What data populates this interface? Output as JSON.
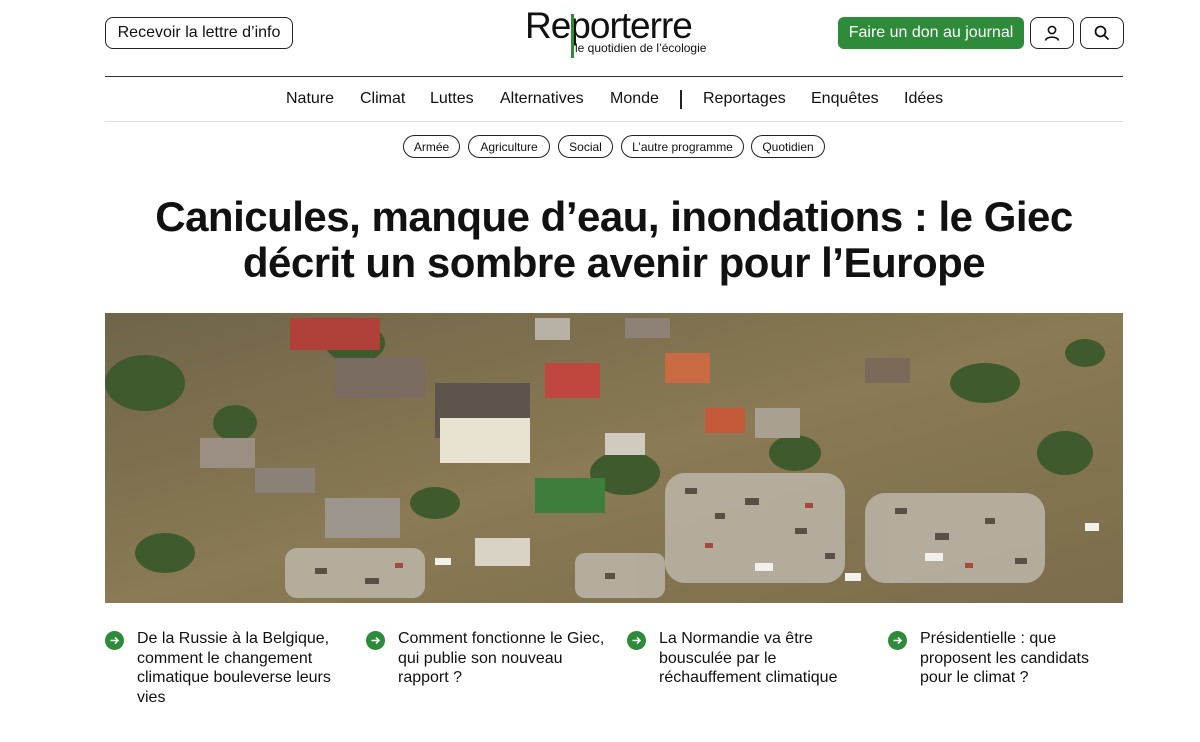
{
  "header": {
    "newsletter_label": "Recevoir la lettre d’info",
    "donate_label": "Faire un don au journal",
    "user_icon": "user-icon",
    "search_icon": "search-icon",
    "logo_text": "Reporterre",
    "logo_tagline": "le quotidien de l’écologie"
  },
  "nav": {
    "items": [
      "Nature",
      "Climat",
      "Luttes",
      "Alternatives",
      "Monde",
      "Reportages",
      "Enquêtes",
      "Idées"
    ]
  },
  "tags": [
    "Armée",
    "Agriculture",
    "Social",
    "L’autre programme",
    "Quotidien"
  ],
  "article": {
    "headline": "Canicules, manque d’eau, inondations : le Giec décrit un sombre avenir pour l’Europe"
  },
  "related": [
    {
      "title": "De la Russie à la Belgique, comment le changement climatique bouleverse leurs vies"
    },
    {
      "title": "Comment fonctionne le Giec, qui publie son nouveau rapport ?"
    },
    {
      "title": "La Normandie va être bousculée par le réchauffement climatique"
    },
    {
      "title": "Présidentielle : que proposent les candidats pour le climat ?"
    }
  ],
  "colors": {
    "brand_green": "#2e8b3a",
    "text": "#111111",
    "flood_water": "#8a7a55"
  }
}
